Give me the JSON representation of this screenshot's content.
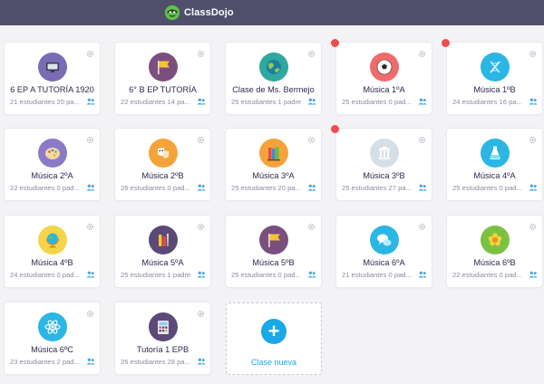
{
  "app": {
    "name": "ClassDojo"
  },
  "colors": {
    "topbar": "#4f4f6b",
    "accent": "#1aa8e6",
    "notification": "#ee4d4d"
  },
  "classes": [
    {
      "name": "6 EP A TUTORÍA 1920",
      "meta": "21 estudiantes 20 pa...",
      "icon": "tv-icon",
      "bg": "#7a6bb5",
      "notification": false
    },
    {
      "name": "6° B EP TUTORÍA",
      "meta": "22 estudiantes 14 pa...",
      "icon": "flag-icon",
      "bg": "#7a4f7e",
      "notification": false
    },
    {
      "name": "Clase de Ms. Bermejo",
      "meta": "25 estudiantes 1 padre",
      "icon": "globe-icon",
      "bg": "#2fa8a0",
      "notification": false
    },
    {
      "name": "Música 1ºA",
      "meta": "25 estudiantes 0 pad...",
      "icon": "soccer-ball-icon",
      "bg": "#f06b6b",
      "notification": true
    },
    {
      "name": "Música 1ºB",
      "meta": "24 estudiantes 16 pa...",
      "icon": "dna-icon",
      "bg": "#2bb6e4",
      "notification": true
    },
    {
      "name": "Música 2ºA",
      "meta": "22 estudiantes 0 pad...",
      "icon": "palette-icon",
      "bg": "#8a7ac8",
      "notification": false
    },
    {
      "name": "Música 2ºB",
      "meta": "26 estudiantes 0 pad...",
      "icon": "theater-masks-icon",
      "bg": "#f4a33a",
      "notification": false
    },
    {
      "name": "Música 3ºA",
      "meta": "25 estudiantes 20 pa...",
      "icon": "books-icon",
      "bg": "#f4a33a",
      "notification": false
    },
    {
      "name": "Música 3ºB",
      "meta": "25 estudiantes 27 pa...",
      "icon": "column-building-icon",
      "bg": "#d7dfe6",
      "notification": true
    },
    {
      "name": "Música 4ºA",
      "meta": "25 estudiantes 0 pad...",
      "icon": "flask-icon",
      "bg": "#2bb6e4",
      "notification": false
    },
    {
      "name": "Música 4ºB",
      "meta": "24 estudiantes 0 pad...",
      "icon": "desk-globe-icon",
      "bg": "#f4d44a",
      "notification": false
    },
    {
      "name": "Música 5ºA",
      "meta": "25 estudiantes 1 padre",
      "icon": "art-supplies-icon",
      "bg": "#5b4a78",
      "notification": false
    },
    {
      "name": "Música 5ºB",
      "meta": "25 estudiantes 0 pad...",
      "icon": "flag-icon",
      "bg": "#7a4f7e",
      "notification": false
    },
    {
      "name": "Música 6ºA",
      "meta": "21 estudiantes 0 pad...",
      "icon": "chat-bubbles-icon",
      "bg": "#2bb6e4",
      "notification": false
    },
    {
      "name": "Música 6ºB",
      "meta": "22 estudiantes 0 pad...",
      "icon": "flower-icon",
      "bg": "#7cc242",
      "notification": false
    },
    {
      "name": "Música 6ºC",
      "meta": "23 estudiantes 2 pad...",
      "icon": "atom-icon",
      "bg": "#2bb6e4",
      "notification": false
    },
    {
      "name": "Tutoría 1 EPB",
      "meta": "26 estudiantes 28 pa...",
      "icon": "calculator-icon",
      "bg": "#5b4a78",
      "notification": false
    }
  ],
  "new_class": {
    "label": "Clase nueva"
  }
}
